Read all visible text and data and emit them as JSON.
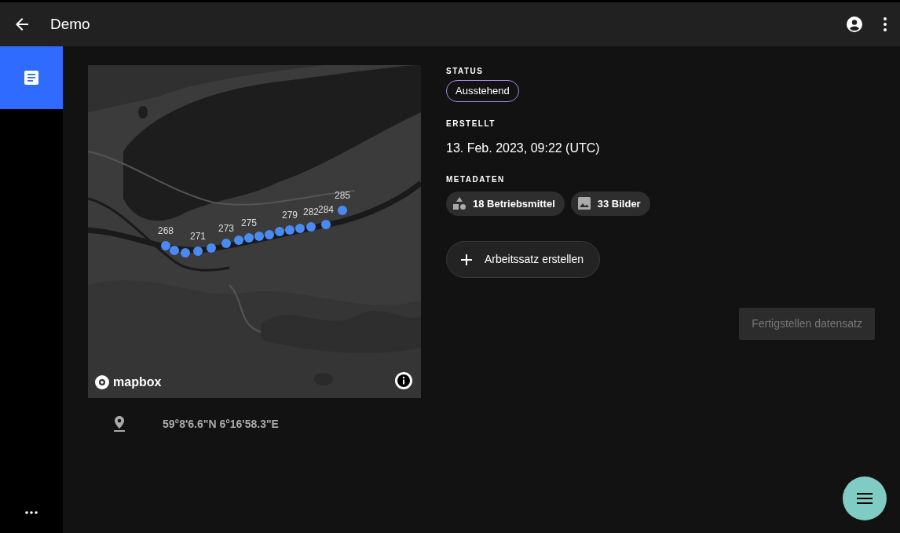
{
  "app_bar": {
    "title": "Demo"
  },
  "nav_rail": {
    "items": [
      {
        "kind": "document",
        "selected": true
      }
    ]
  },
  "map": {
    "attribution": "mapbox",
    "markers": [
      {
        "kind": "labeled",
        "label": "268"
      },
      {
        "kind": "plain"
      },
      {
        "kind": "plain"
      },
      {
        "kind": "labeled",
        "label": "271"
      },
      {
        "kind": "plain"
      },
      {
        "kind": "labeled",
        "label": "273"
      },
      {
        "kind": "plain"
      },
      {
        "kind": "labeled",
        "label": "275"
      },
      {
        "kind": "plain"
      },
      {
        "kind": "plain"
      },
      {
        "kind": "plain"
      },
      {
        "kind": "labeled",
        "label": "279"
      },
      {
        "kind": "plain"
      },
      {
        "kind": "labeled",
        "label": "282"
      },
      {
        "kind": "labeled",
        "label": "284"
      },
      {
        "kind": "labeled",
        "label": "285"
      }
    ]
  },
  "location": {
    "coordinates": "59°8'6.6\"N 6°16'58.3\"E"
  },
  "details": {
    "status_label": "STATUS",
    "status": "Ausstehend",
    "created_label": "ERSTELLT",
    "created": "13. Feb. 2023, 09:22 (UTC)",
    "metadata_label": "METADATEN",
    "metadata": [
      {
        "kind": "assets",
        "text": "18 Betriebsmittel"
      },
      {
        "kind": "images",
        "text": "33 Bilder"
      }
    ]
  },
  "create_button": {
    "label": "Arbeitssatz erstellen"
  },
  "finish_button": {
    "label": "Fertigstellen datensatz",
    "disabled": true
  }
}
